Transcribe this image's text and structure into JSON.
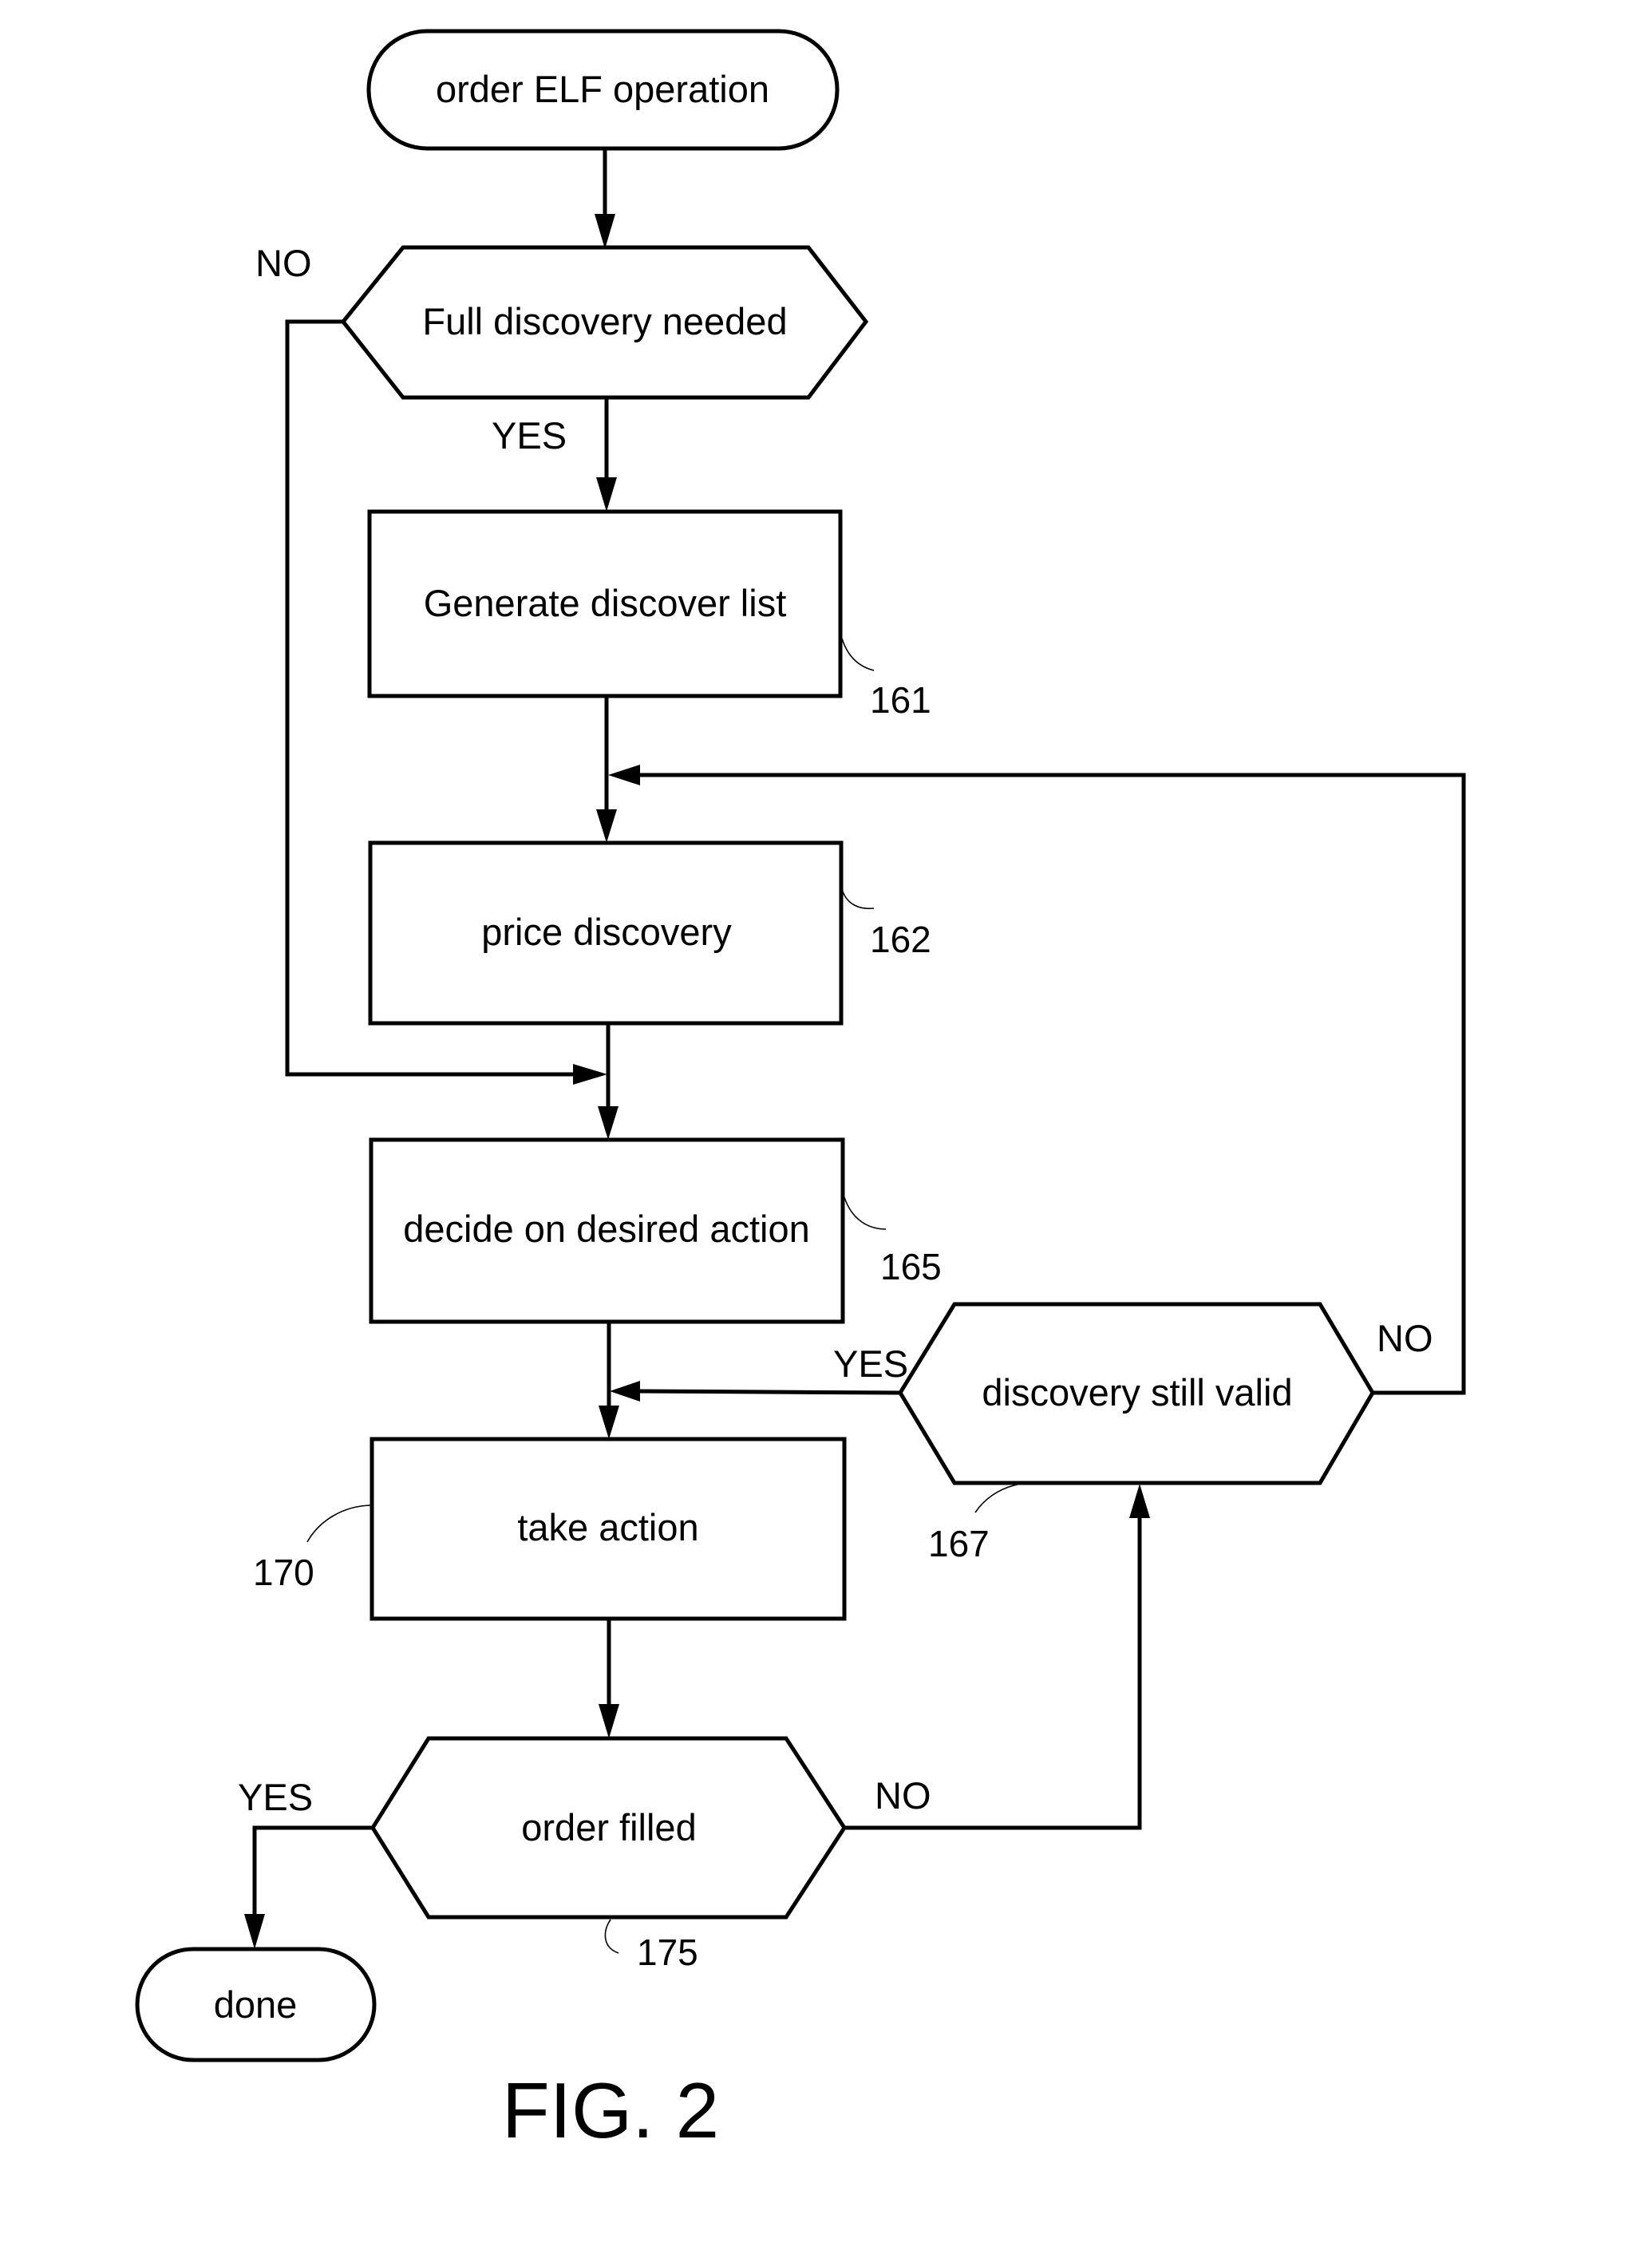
{
  "figure": {
    "caption": "FIG. 2"
  },
  "nodes": {
    "start": {
      "text": "order ELF operation",
      "shape": "terminal"
    },
    "full_discovery": {
      "text": "Full discovery needed",
      "shape": "decision"
    },
    "generate_list": {
      "text": "Generate discover list",
      "shape": "process",
      "ref": "161"
    },
    "price_discovery": {
      "text": "price discovery",
      "shape": "process",
      "ref": "162"
    },
    "decide_action": {
      "text": "decide on desired action",
      "shape": "process",
      "ref": "165"
    },
    "discovery_valid": {
      "text": "discovery still valid",
      "shape": "decision",
      "ref": "167"
    },
    "take_action": {
      "text": "take action",
      "shape": "process",
      "ref": "170"
    },
    "order_filled": {
      "text": "order filled",
      "shape": "decision",
      "ref": "175"
    },
    "done": {
      "text": "done",
      "shape": "terminal"
    }
  },
  "edge_labels": {
    "full_discovery_no": "NO",
    "full_discovery_yes": "YES",
    "discovery_valid_yes": "YES",
    "discovery_valid_no": "NO",
    "order_filled_yes": "YES",
    "order_filled_no": "NO"
  },
  "edges": [
    {
      "from": "start",
      "to": "full_discovery"
    },
    {
      "from": "full_discovery",
      "to": "generate_list",
      "label": "YES"
    },
    {
      "from": "full_discovery",
      "to": "decide_action",
      "label": "NO"
    },
    {
      "from": "generate_list",
      "to": "price_discovery"
    },
    {
      "from": "price_discovery",
      "to": "decide_action"
    },
    {
      "from": "decide_action",
      "to": "take_action"
    },
    {
      "from": "take_action",
      "to": "order_filled"
    },
    {
      "from": "order_filled",
      "to": "done",
      "label": "YES"
    },
    {
      "from": "order_filled",
      "to": "discovery_valid",
      "label": "NO"
    },
    {
      "from": "discovery_valid",
      "to": "take_action",
      "label": "YES"
    },
    {
      "from": "discovery_valid",
      "to": "price_discovery",
      "label": "NO"
    }
  ]
}
